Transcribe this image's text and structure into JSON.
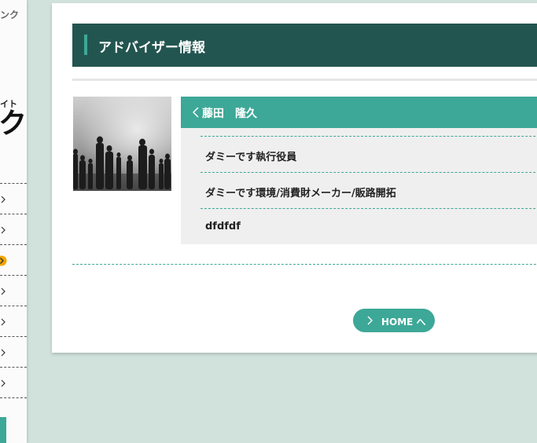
{
  "sidebar": {
    "top_text": "ンク",
    "site_label": "イト",
    "brand_text": "ク",
    "items": [
      {
        "name": "item-1"
      },
      {
        "name": "item-2"
      },
      {
        "name": "item-3",
        "active": true
      },
      {
        "name": "item-4"
      },
      {
        "name": "item-5"
      },
      {
        "name": "item-6"
      },
      {
        "name": "item-7"
      }
    ],
    "active_color": "#f0a500"
  },
  "page": {
    "title": "アドバイザー情報"
  },
  "profile": {
    "photo_description_icon": "people-silhouette-photo",
    "name": "藤田　隆久",
    "fields": [
      "ダミーです執行役員",
      "ダミーです環境/消費財メーカー/販路開拓",
      "dfdfdf"
    ]
  },
  "home_button": {
    "label": "HOME へ"
  },
  "colors": {
    "background": "#d1e2dc",
    "title_bar": "#235550",
    "accent": "#3da897",
    "panel": "#efefef"
  }
}
